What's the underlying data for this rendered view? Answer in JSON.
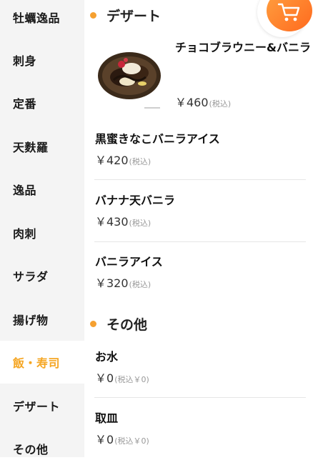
{
  "sidebar": {
    "items": [
      {
        "label": "牡蠣逸品"
      },
      {
        "label": "刺身"
      },
      {
        "label": "定番"
      },
      {
        "label": "天麩羅"
      },
      {
        "label": "逸品"
      },
      {
        "label": "肉刺"
      },
      {
        "label": "サラダ"
      },
      {
        "label": "揚げ物"
      },
      {
        "label": "飯・寿司",
        "active": true
      },
      {
        "label": "デザート"
      },
      {
        "label": "その他"
      }
    ]
  },
  "sections": {
    "dessert": {
      "title": "デザート",
      "items": [
        {
          "name": "チョコブラウニー&バニラ",
          "price": "￥460",
          "tax": "(税込)"
        },
        {
          "name": "黒蜜きなこバニラアイス",
          "price": "￥420",
          "tax": "(税込)"
        },
        {
          "name": "バナナ天バニラ",
          "price": "￥430",
          "tax": "(税込)"
        },
        {
          "name": "バニラアイス",
          "price": "￥320",
          "tax": "(税込)"
        }
      ]
    },
    "other": {
      "title": "その他",
      "items": [
        {
          "name": "お水",
          "price": "￥0",
          "tax": "(税込￥0)"
        },
        {
          "name": "取皿",
          "price": "￥0",
          "tax": "(税込￥0)"
        }
      ]
    }
  },
  "colors": {
    "accent": "#f5a623",
    "cart_gradient_start": "#ffa040",
    "cart_gradient_end": "#ff6a1e"
  },
  "icons": {
    "cart": "cart-icon"
  }
}
